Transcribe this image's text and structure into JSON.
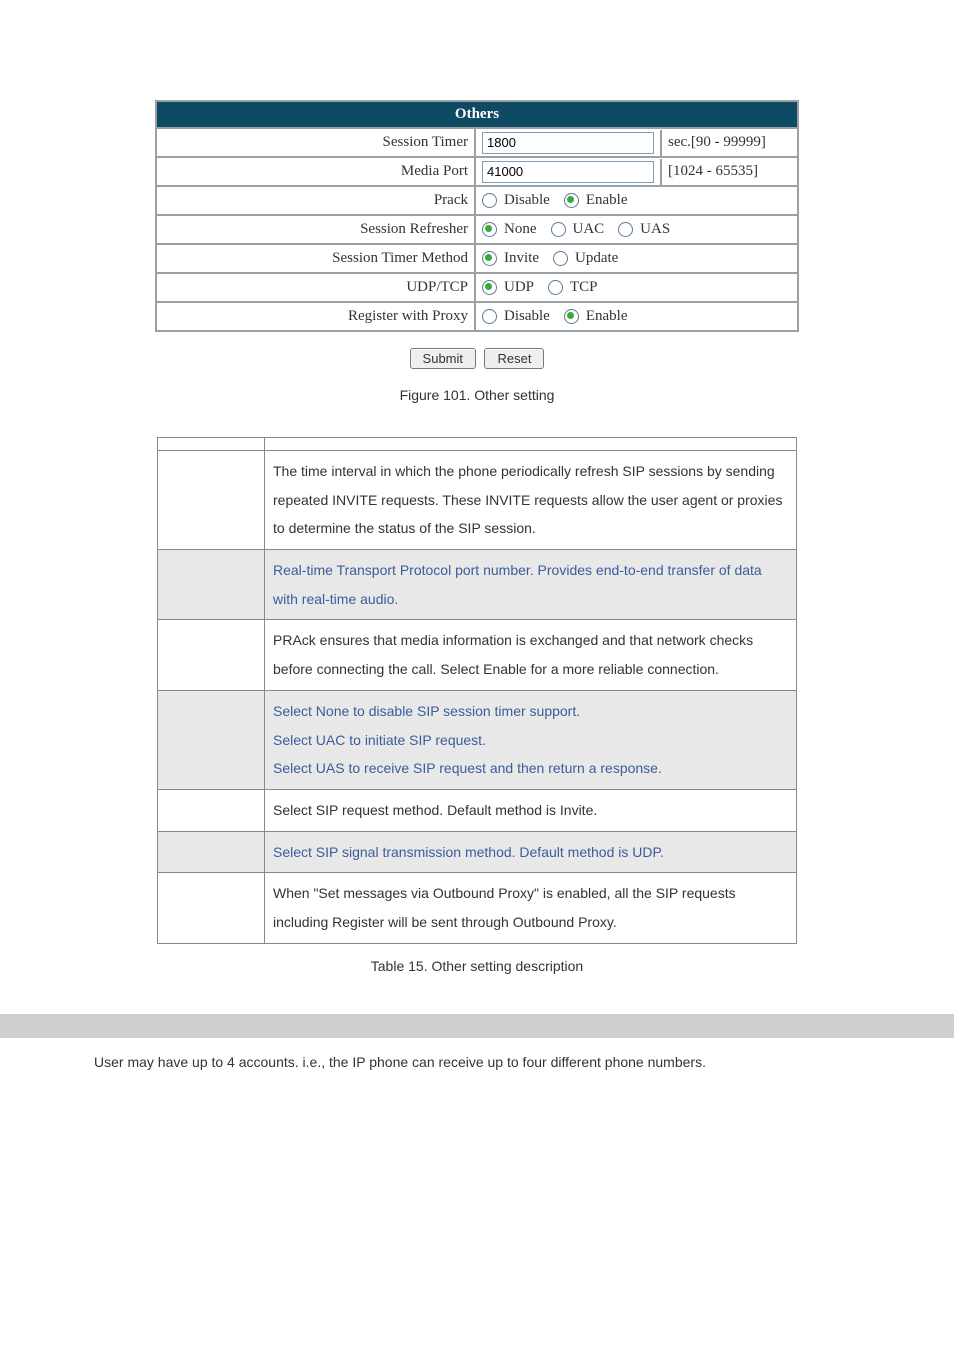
{
  "panel": {
    "title": "Others",
    "rows": {
      "session_timer": {
        "label": "Session Timer",
        "value": "1800",
        "range": "sec.[90 - 99999]"
      },
      "media_port": {
        "label": "Media Port",
        "value": "41000",
        "range": "[1024 - 65535]"
      },
      "prack": {
        "label": "Prack",
        "opts": {
          "disable": "Disable",
          "enable": "Enable"
        }
      },
      "refresher": {
        "label": "Session Refresher",
        "opts": {
          "none": "None",
          "uac": "UAC",
          "uas": "UAS"
        }
      },
      "timer_method": {
        "label": "Session Timer Method",
        "opts": {
          "invite": "Invite",
          "update": "Update"
        }
      },
      "udptcp": {
        "label": "UDP/TCP",
        "opts": {
          "udp": "UDP",
          "tcp": "TCP"
        }
      },
      "register_proxy": {
        "label": "Register with Proxy",
        "opts": {
          "disable": "Disable",
          "enable": "Enable"
        }
      }
    },
    "buttons": {
      "submit": "Submit",
      "reset": "Reset"
    }
  },
  "figure_caption": "Figure 101. Other setting",
  "desc": {
    "rows": [
      {
        "shaded": false,
        "text": ""
      },
      {
        "shaded": false,
        "text": "The time interval in which the phone periodically refresh SIP sessions by sending repeated INVITE requests. These INVITE requests allow the user agent or proxies to determine the status of the SIP session."
      },
      {
        "shaded": true,
        "text": "Real-time Transport Protocol port number. Provides end-to-end transfer of data with real-time audio."
      },
      {
        "shaded": false,
        "text": "PRAck ensures that media information is exchanged and that network checks before connecting the call. Select Enable for a more reliable connection."
      },
      {
        "shaded": true,
        "text": "Select None to disable SIP session timer support.\nSelect UAC to initiate SIP request.\nSelect UAS to receive SIP request and then return a response."
      },
      {
        "shaded": false,
        "text": "Select SIP request method. Default method is Invite."
      },
      {
        "shaded": true,
        "text": "Select SIP signal transmission method. Default method is UDP."
      },
      {
        "shaded": false,
        "text": "When \"Set messages via Outbound Proxy\" is enabled, all the SIP requests including Register will be sent through Outbound Proxy."
      }
    ]
  },
  "table_caption": "Table 15. Other setting description",
  "paragraph": "User may have up to 4 accounts. i.e., the IP phone can receive up to four different phone numbers."
}
